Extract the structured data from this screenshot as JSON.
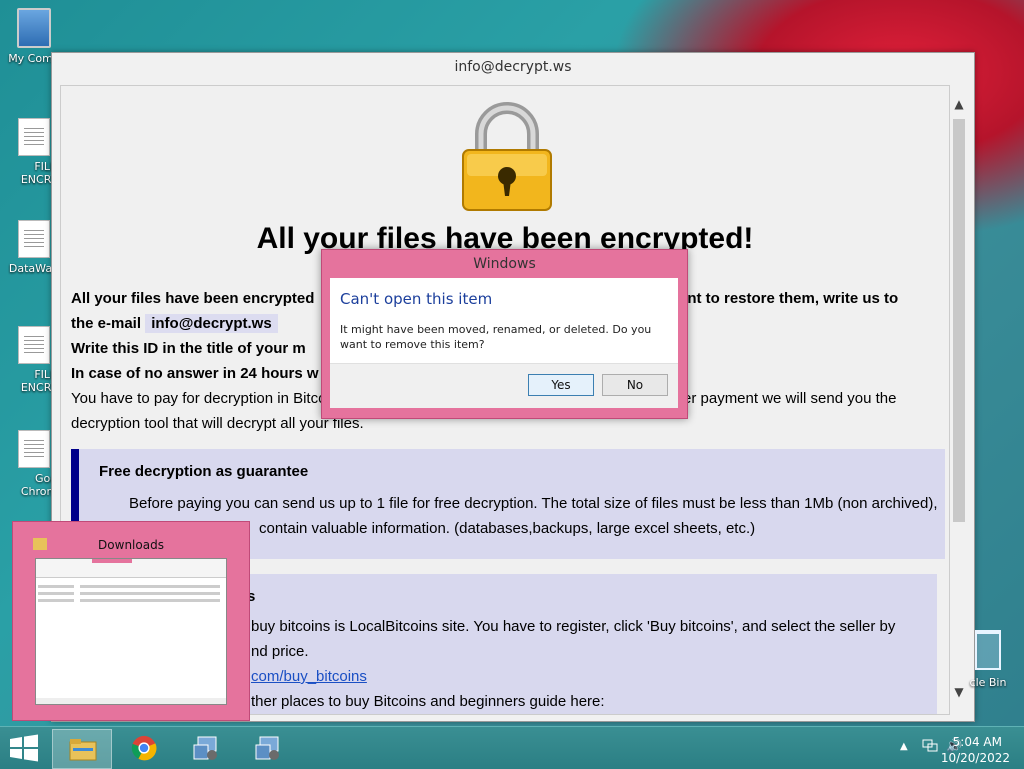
{
  "desktop": {
    "icons": [
      {
        "label": "My Comp"
      },
      {
        "label": "FILES\nENCRYP"
      },
      {
        "label": "DataWag"
      },
      {
        "label": "FILES\nENCRYP"
      },
      {
        "label": "Goog\nChrome"
      }
    ],
    "recycle_bin_label": "cle Bin"
  },
  "ransom_window": {
    "title": "info@decrypt.ws",
    "heading": "All your files have been encrypted!",
    "line1_start": "All your files have been encrypted",
    "line1_end": "ant to restore them, write us to",
    "email_prefix": "the e-mail",
    "email": "info@decrypt.ws",
    "line3": "Write this ID in the title of your m",
    "line4": "In case of no answer in 24 hours w",
    "line5_start": "You have to pay for decryption in Bitco",
    "line5_end": "er payment we will send you the",
    "line6": "decryption tool that will decrypt all your files.",
    "guarantee": {
      "title": "Free decryption as guarantee",
      "text1": "Before paying you can send us up to 1 file for free decryption. The total size of files must be less than 1Mb (non archived),",
      "text2": "contain valuable information. (databases,backups, large excel sheets, etc.)"
    },
    "bitcoins": {
      "title_fragment": "s",
      "text1": "buy bitcoins is LocalBitcoins site. You have to register, click 'Buy bitcoins', and select the seller by",
      "text2": "nd price.",
      "link": "com/buy_bitcoins",
      "text3": "ther places to buy Bitcoins and beginners guide here:"
    }
  },
  "dialog": {
    "window_title": "Windows",
    "heading": "Can't open this item",
    "message": "It might have been moved, renamed, or deleted. Do you want to remove this item?",
    "yes_label": "Yes",
    "no_label": "No"
  },
  "thumbnail": {
    "title": "Downloads"
  },
  "taskbar": {
    "time": "5:04 AM",
    "date": "10/20/2022",
    "tray_arrow": "▲",
    "volume_glyph": "🔊"
  },
  "colors": {
    "dialog_frame": "#e5739d",
    "dialog_heading": "#1c3f9c",
    "link": "#1a4fc4",
    "guarantee_border": "#00008b",
    "box_background": "#d8d8ee"
  }
}
